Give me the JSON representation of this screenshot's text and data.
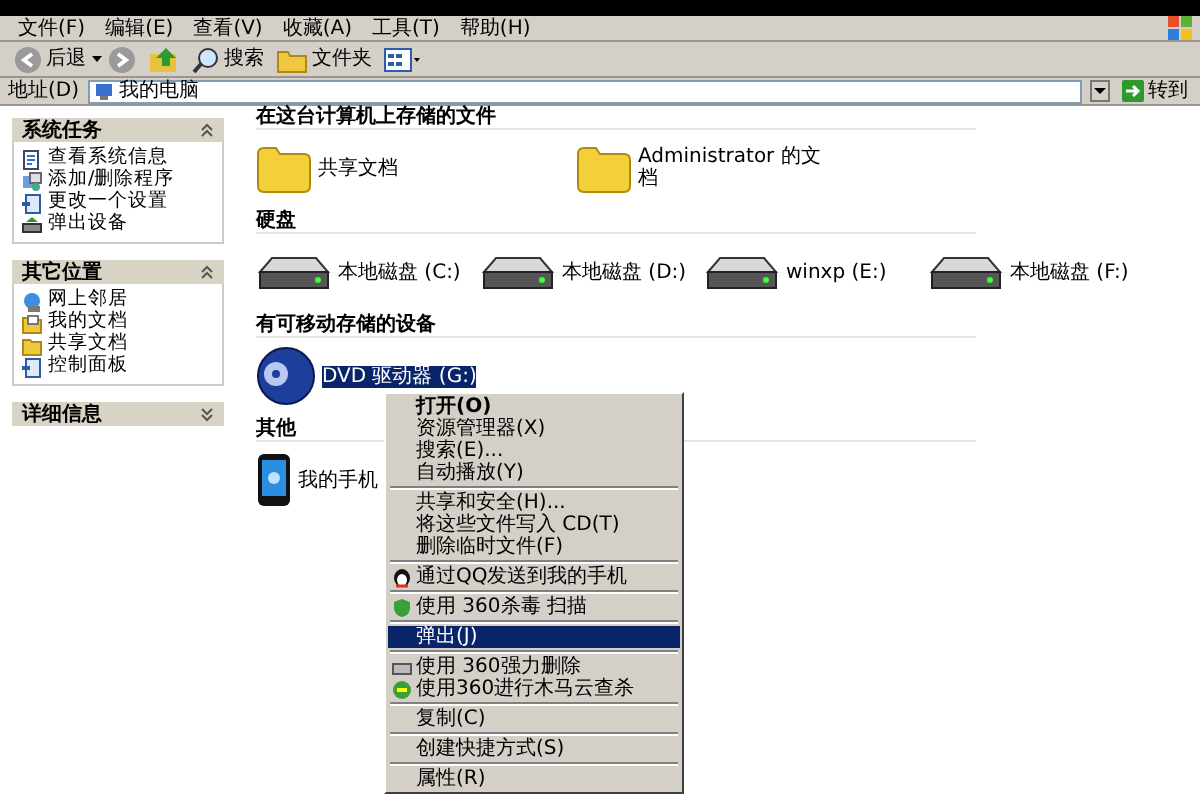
{
  "menu_bar": [
    {
      "label": "文件(F)"
    },
    {
      "label": "编辑(E)"
    },
    {
      "label": "查看(V)"
    },
    {
      "label": "收藏(A)"
    },
    {
      "label": "工具(T)"
    },
    {
      "label": "帮助(H)"
    }
  ],
  "toolbar": {
    "back": "后退",
    "search": "搜索",
    "folders": "文件夹"
  },
  "address_bar": {
    "label": "地址(D)",
    "value": "我的电脑",
    "go": "转到"
  },
  "sidebar": [
    {
      "title": "系统任务",
      "expanded": true,
      "items": [
        {
          "label": "查看系统信息",
          "kind": "info"
        },
        {
          "label": "添加/删除程序",
          "kind": "programs"
        },
        {
          "label": "更改一个设置",
          "kind": "settings"
        },
        {
          "label": "弹出设备",
          "kind": "eject"
        }
      ]
    },
    {
      "title": "其它位置",
      "expanded": true,
      "items": [
        {
          "label": "网上邻居",
          "kind": "network"
        },
        {
          "label": "我的文档",
          "kind": "documents"
        },
        {
          "label": "共享文档",
          "kind": "folder"
        },
        {
          "label": "控制面板",
          "kind": "settings"
        }
      ]
    },
    {
      "title": "详细信息",
      "expanded": false
    }
  ],
  "sections": [
    {
      "title": "在这台计算机上存储的文件",
      "items": [
        {
          "label": "共享文档",
          "kind": "folder",
          "selected": false
        },
        {
          "label": "Administrator 的文档",
          "kind": "folder",
          "selected": false
        }
      ]
    },
    {
      "title": "硬盘",
      "items": [
        {
          "label": "本地磁盘 (C:)",
          "kind": "drive",
          "selected": false
        },
        {
          "label": "本地磁盘 (D:)",
          "kind": "drive",
          "selected": false
        },
        {
          "label": "winxp (E:)",
          "kind": "drive",
          "selected": false
        },
        {
          "label": "本地磁盘 (F:)",
          "kind": "drive",
          "selected": false
        }
      ]
    },
    {
      "title": "有可移动存储的设备",
      "items": [
        {
          "label": "DVD 驱动器 (G:)",
          "kind": "cd",
          "selected": true
        }
      ]
    },
    {
      "title": "其他",
      "items": [
        {
          "label": "我的手机",
          "kind": "phone",
          "selected": false
        }
      ]
    }
  ],
  "context_menu": [
    {
      "kind": "item",
      "label": "打开(O)",
      "bold": true,
      "selected": false
    },
    {
      "kind": "item",
      "label": "资源管理器(X)",
      "selected": false
    },
    {
      "kind": "item",
      "label": "搜索(E)...",
      "selected": false
    },
    {
      "kind": "item",
      "label": "自动播放(Y)",
      "selected": false
    },
    {
      "kind": "separator"
    },
    {
      "kind": "item",
      "label": "共享和安全(H)...",
      "selected": false
    },
    {
      "kind": "item",
      "label": "将这些文件写入 CD(T)",
      "selected": false
    },
    {
      "kind": "item",
      "label": "删除临时文件(F)",
      "selected": false
    },
    {
      "kind": "separator"
    },
    {
      "kind": "qq",
      "label": "通过QQ发送到我的手机",
      "selected": false
    },
    {
      "kind": "separator"
    },
    {
      "kind": "antivirus",
      "label": "使用 360杀毒 扫描",
      "selected": false
    },
    {
      "kind": "separator"
    },
    {
      "kind": "item",
      "label": "弹出(J)",
      "selected": true
    },
    {
      "kind": "separator"
    },
    {
      "kind": "shredder",
      "label": "使用 360强力删除",
      "selected": false
    },
    {
      "kind": "trojan",
      "label": "使用360进行木马云查杀",
      "selected": false
    },
    {
      "kind": "separator"
    },
    {
      "kind": "item",
      "label": "复制(C)",
      "selected": false
    },
    {
      "kind": "separator"
    },
    {
      "kind": "item",
      "label": "创建快捷方式(S)",
      "selected": false
    },
    {
      "kind": "separator"
    },
    {
      "kind": "item",
      "label": "属性(R)",
      "selected": false
    }
  ]
}
